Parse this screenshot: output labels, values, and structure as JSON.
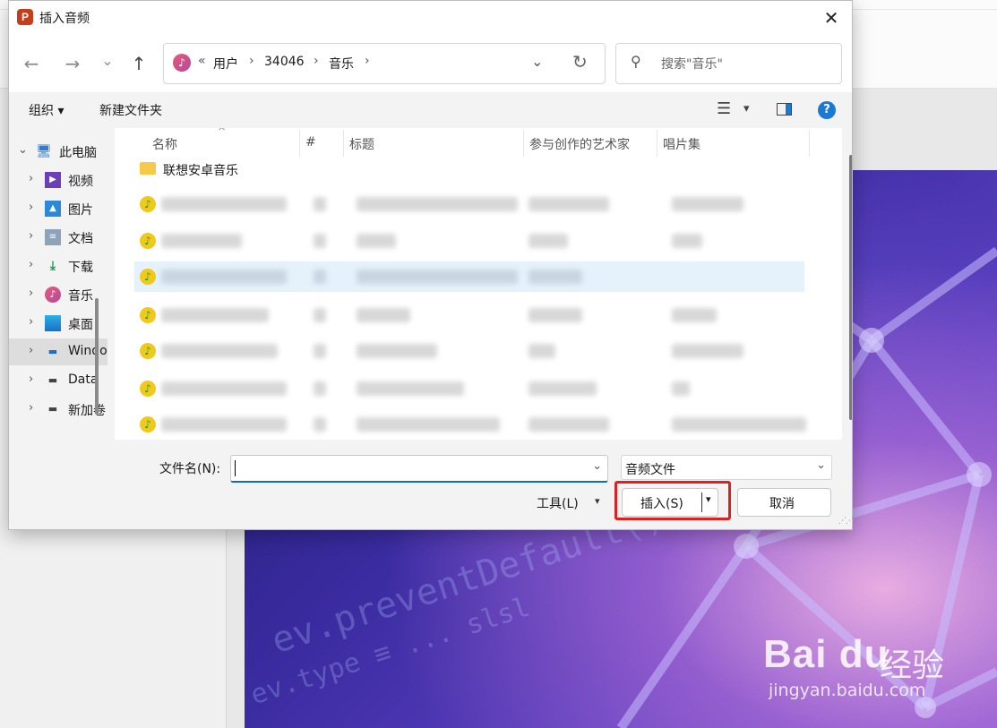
{
  "dialog": {
    "title": "插入音频",
    "app_icon_letter": "P",
    "close_glyph": "✕"
  },
  "nav": {
    "back_glyph": "←",
    "forward_glyph": "→",
    "recent_glyph": "⌄",
    "up_glyph": "↑"
  },
  "address": {
    "overflow": "«",
    "crumbs": [
      "用户",
      "34046",
      "音乐"
    ],
    "sep": "›"
  },
  "search": {
    "placeholder": "搜索\"音乐\""
  },
  "toolbar": {
    "organize": "组织 ▾",
    "new_folder": "新建文件夹",
    "view_glyph": "☰",
    "view_dd_glyph": "▾",
    "help": "?"
  },
  "nav_pane": {
    "items": [
      {
        "label": "此电脑",
        "icon": "computer-icon",
        "expanded": true
      },
      {
        "label": "视频",
        "icon": "video-icon"
      },
      {
        "label": "图片",
        "icon": "picture-icon"
      },
      {
        "label": "文档",
        "icon": "document-icon"
      },
      {
        "label": "下载",
        "icon": "download-icon"
      },
      {
        "label": "音乐",
        "icon": "music-icon"
      },
      {
        "label": "桌面",
        "icon": "desktop-icon"
      },
      {
        "label": "Windows",
        "icon": "drive-icon",
        "selected": true
      },
      {
        "label": "Data",
        "icon": "drive-icon"
      },
      {
        "label": "新加卷",
        "icon": "drive-icon"
      }
    ]
  },
  "columns": [
    "名称",
    "#",
    "标题",
    "参与创作的艺术家",
    "唱片集"
  ],
  "folder_row": {
    "label": "联想安卓音乐"
  },
  "bottom": {
    "filename_label": "文件名(N):",
    "filename_value": "",
    "filetype": "音频文件",
    "tools": "工具(L)",
    "tools_dd": "▾",
    "insert": "插入(S)",
    "insert_dd": "▾",
    "cancel": "取消"
  },
  "colors": {
    "accent": "#0a6cc2",
    "highlight": "#e02020",
    "help": "#1b79d4"
  }
}
